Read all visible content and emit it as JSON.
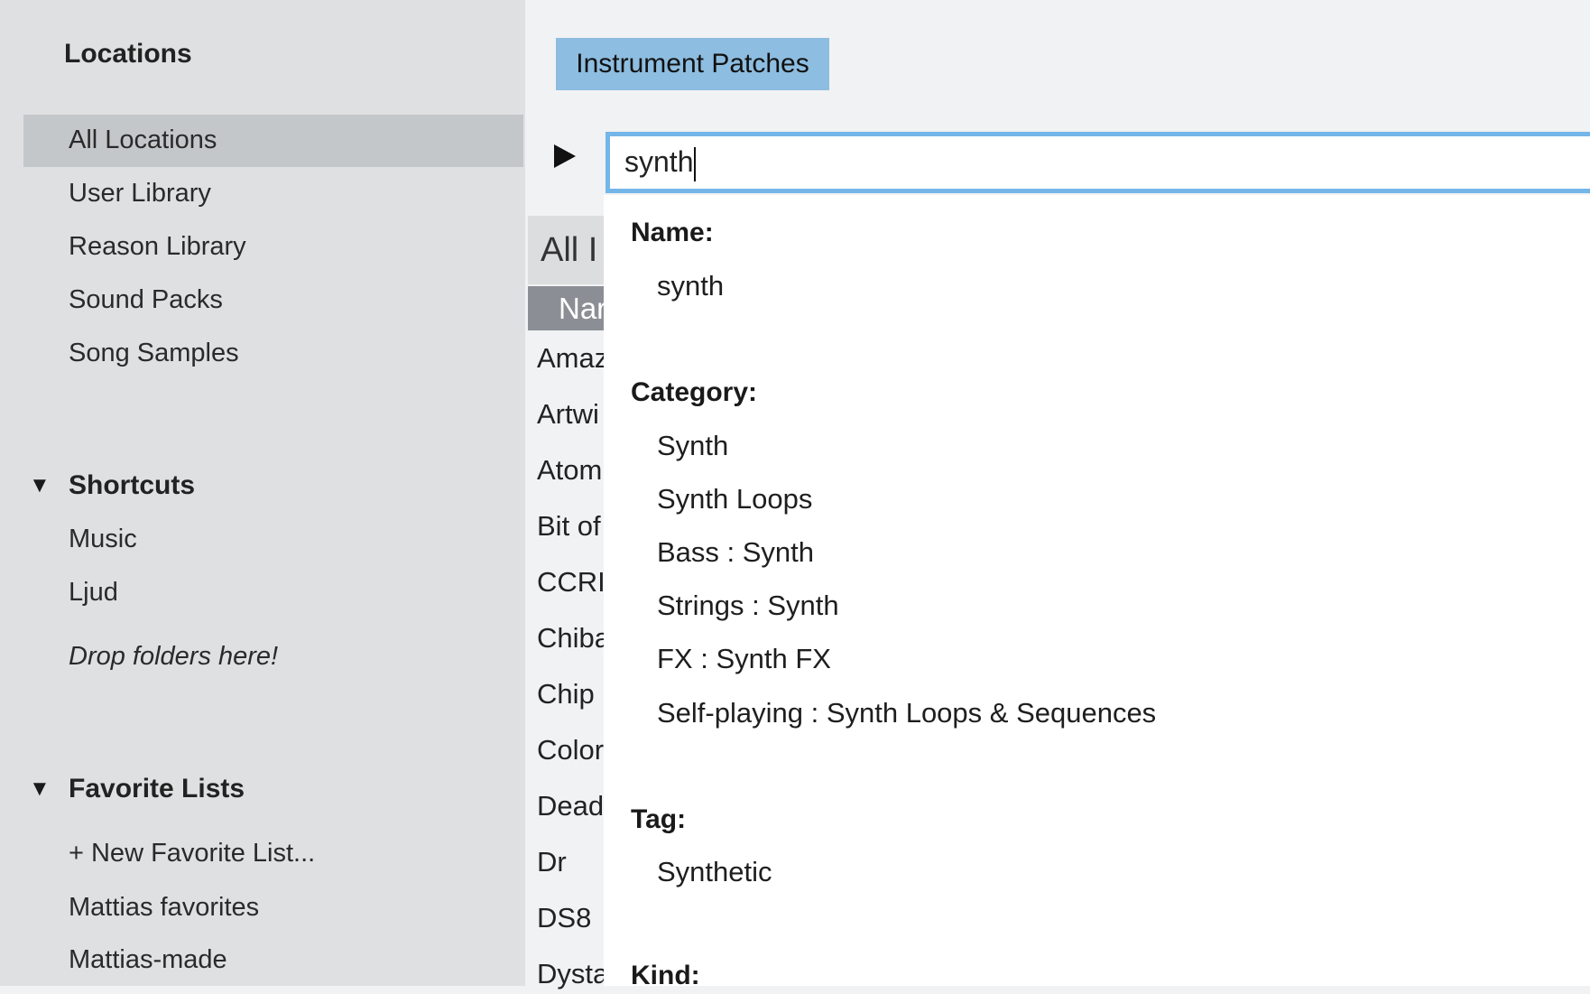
{
  "sidebar": {
    "locations_title": "Locations",
    "locations": [
      "All Locations",
      "User Library",
      "Reason Library",
      "Sound Packs",
      "Song Samples"
    ],
    "selected_location": "All Locations",
    "shortcuts_title": "Shortcuts",
    "shortcuts": [
      "Music",
      "Ljud"
    ],
    "drop_hint": "Drop folders here!",
    "favorites_title": "Favorite Lists",
    "new_favorite": "+ New Favorite List...",
    "favorites": [
      "Mattias favorites",
      "Mattias-made"
    ]
  },
  "main": {
    "patch_button": "Instrument Patches",
    "search_value": "synth",
    "header_partial": "All I",
    "column_partial": "Nar",
    "list_partial": [
      "Amaz",
      "Artwi",
      "Atom",
      "Bit of",
      "CCRI",
      "Chiba",
      "Chip",
      "Color",
      "Dead",
      "Dr Ru",
      "DS8",
      "Dysta"
    ]
  },
  "dropdown": {
    "name_label": "Name:",
    "name_items": [
      "synth"
    ],
    "category_label": "Category:",
    "category_items": [
      "Synth",
      "Synth Loops",
      "Bass : Synth",
      "Strings : Synth",
      "FX : Synth FX",
      "Self-playing : Synth Loops & Sequences"
    ],
    "tag_label": "Tag:",
    "tag_items": [
      "Synthetic"
    ],
    "kind_label": "Kind:"
  },
  "colors": {
    "accent": "#8dbde0",
    "search_border": "#74b6e8",
    "selection": "#c4c7ca",
    "column_header": "#8b8f95"
  }
}
